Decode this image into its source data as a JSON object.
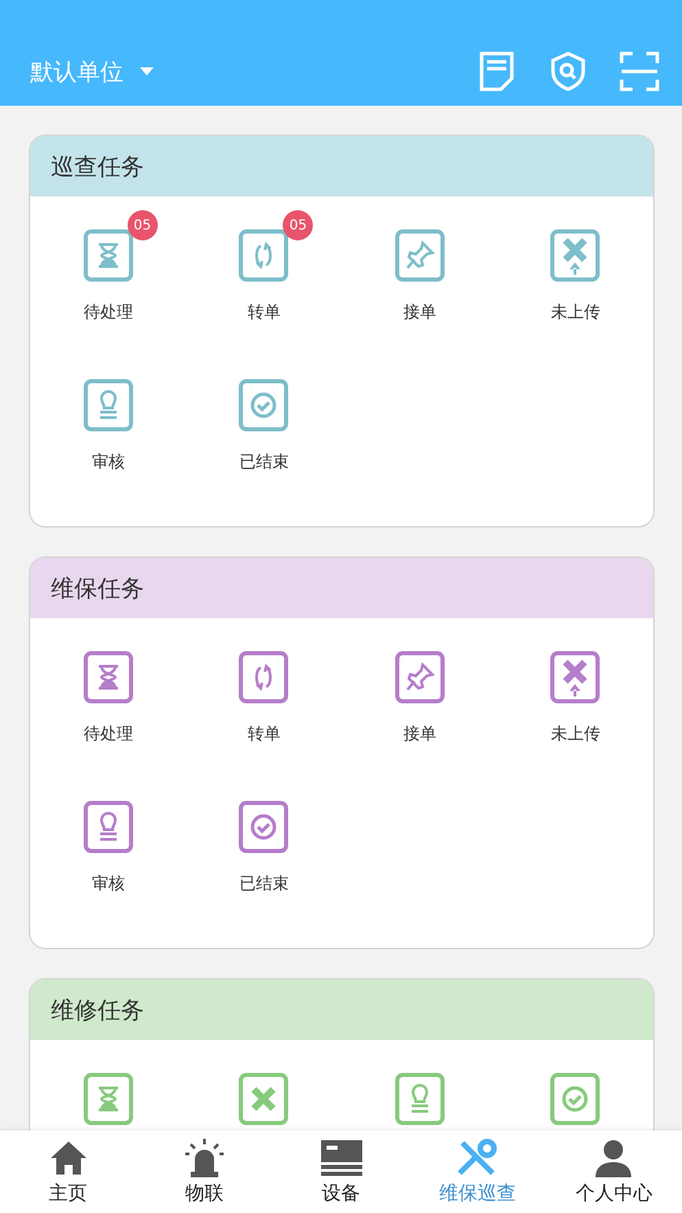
{
  "header": {
    "unit": "默认单位"
  },
  "sections": [
    {
      "title": "巡查任务",
      "color": "#c3e4ea",
      "items": [
        {
          "kind": "hourglass",
          "label": "待处理",
          "badge": "05"
        },
        {
          "kind": "transfer",
          "label": "转单",
          "badge": "05"
        },
        {
          "kind": "pin",
          "label": "接单"
        },
        {
          "kind": "upload",
          "label": "未上传"
        },
        {
          "kind": "stamp",
          "label": "审核"
        },
        {
          "kind": "check",
          "label": "已结束"
        }
      ]
    },
    {
      "title": "维保任务",
      "color": "#e8d7ee",
      "items": [
        {
          "kind": "hourglass",
          "label": "待处理"
        },
        {
          "kind": "transfer",
          "label": "转单"
        },
        {
          "kind": "pin",
          "label": "接单"
        },
        {
          "kind": "upload",
          "label": "未上传"
        },
        {
          "kind": "stamp",
          "label": "审核"
        },
        {
          "kind": "check",
          "label": "已结束"
        }
      ]
    },
    {
      "title": "维修任务",
      "color": "#d0e9cc",
      "items": [
        {
          "kind": "hourglass"
        },
        {
          "kind": "cross"
        },
        {
          "kind": "stamp"
        },
        {
          "kind": "check"
        }
      ]
    }
  ],
  "nav": [
    {
      "kind": "home",
      "label": "主页",
      "selected": false
    },
    {
      "kind": "alarm",
      "label": "物联",
      "selected": false
    },
    {
      "kind": "device",
      "label": "设备",
      "selected": false
    },
    {
      "kind": "tools",
      "label": "维保巡查",
      "selected": true
    },
    {
      "kind": "person",
      "label": "个人中心",
      "selected": false
    }
  ]
}
